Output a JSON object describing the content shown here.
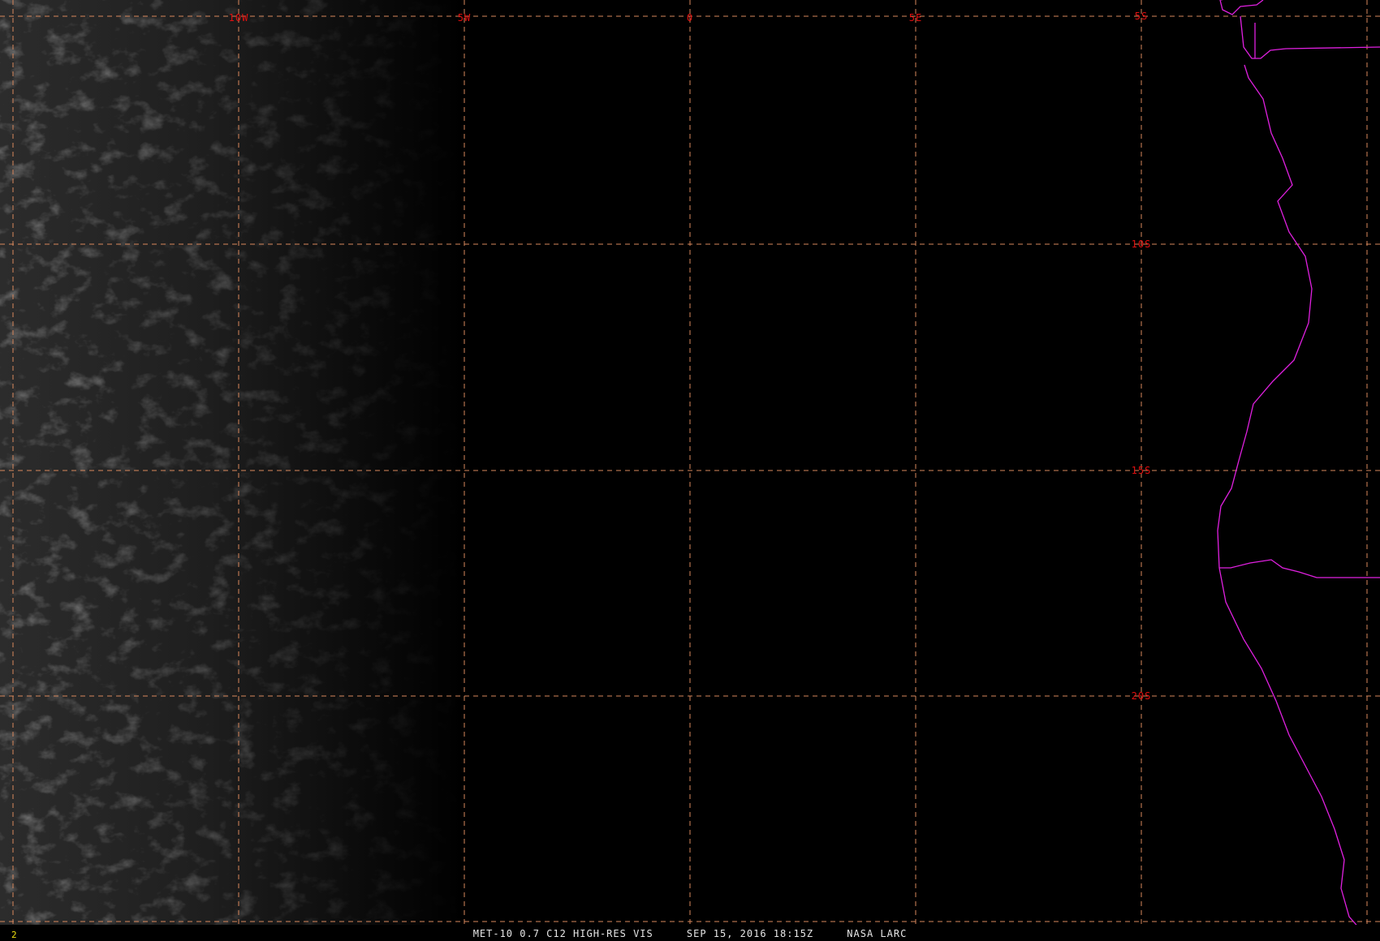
{
  "colors": {
    "background": "#000000",
    "graticule": "#d9885c",
    "graticule_label": "#e01010",
    "political_boundary": "#e020e0",
    "frame_number": "#f0e010",
    "caption": "#e6e6e6"
  },
  "icons": {
    "imagery": "satellite-visible-imagery",
    "boundary": "coastline-magenta"
  },
  "map": {
    "longitude_labels": [
      "10W",
      "5W",
      "0",
      "5E"
    ],
    "latitude_labels": [
      "5S",
      "10S",
      "15S",
      "20S"
    ]
  },
  "status": {
    "frame_number": "2",
    "caption": "MET-10 0.7 C12 HIGH-RES VIS     SEP 15, 2016 18:15Z     NASA LARC"
  }
}
